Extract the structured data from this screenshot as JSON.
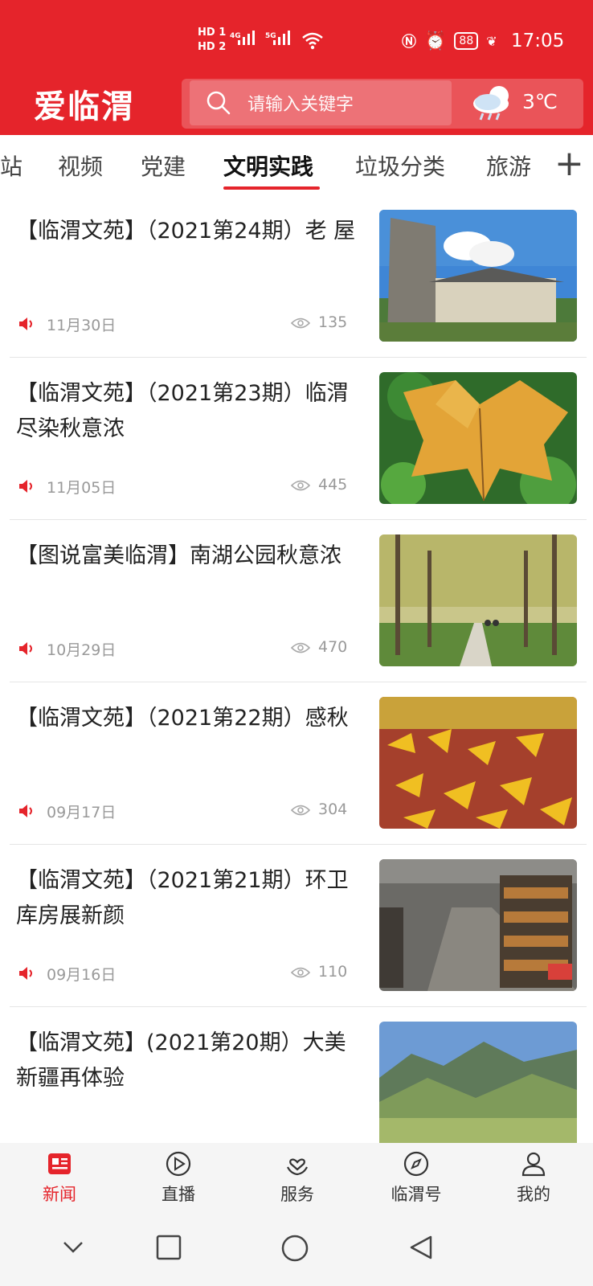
{
  "status_bar": {
    "hd1": "HD 1",
    "hd2": "HD 2",
    "net1": "4G",
    "net2": "5G",
    "battery": "88",
    "time": "17:05"
  },
  "header": {
    "logo": "爱临渭",
    "search_placeholder": "请输入关键字",
    "temperature": "3℃"
  },
  "tabs": [
    "站",
    "视频",
    "党建",
    "文明实践",
    "垃圾分类",
    "旅游"
  ],
  "active_tab": "文明实践",
  "articles": [
    {
      "title": "【临渭文苑】（2021第24期）老 屋",
      "date": "11月30日",
      "views": "135"
    },
    {
      "title": "【临渭文苑】（2021第23期）临渭尽染秋意浓",
      "date": "11月05日",
      "views": "445"
    },
    {
      "title": "【图说富美临渭】南湖公园秋意浓",
      "date": "10月29日",
      "views": "470"
    },
    {
      "title": "【临渭文苑】（2021第22期）感秋",
      "date": "09月17日",
      "views": "304"
    },
    {
      "title": "【临渭文苑】（2021第21期）环卫库房展新颜",
      "date": "09月16日",
      "views": "110"
    },
    {
      "title": "【临渭文苑】(2021第20期）大美新疆再体验",
      "date": "",
      "views": ""
    }
  ],
  "bottom_nav": [
    {
      "label": "新闻",
      "icon": "news-icon"
    },
    {
      "label": "直播",
      "icon": "play-icon"
    },
    {
      "label": "服务",
      "icon": "service-icon"
    },
    {
      "label": "临渭号",
      "icon": "compass-icon"
    },
    {
      "label": "我的",
      "icon": "user-icon"
    }
  ],
  "colors": {
    "brand": "#e5242b",
    "muted": "#999999"
  }
}
